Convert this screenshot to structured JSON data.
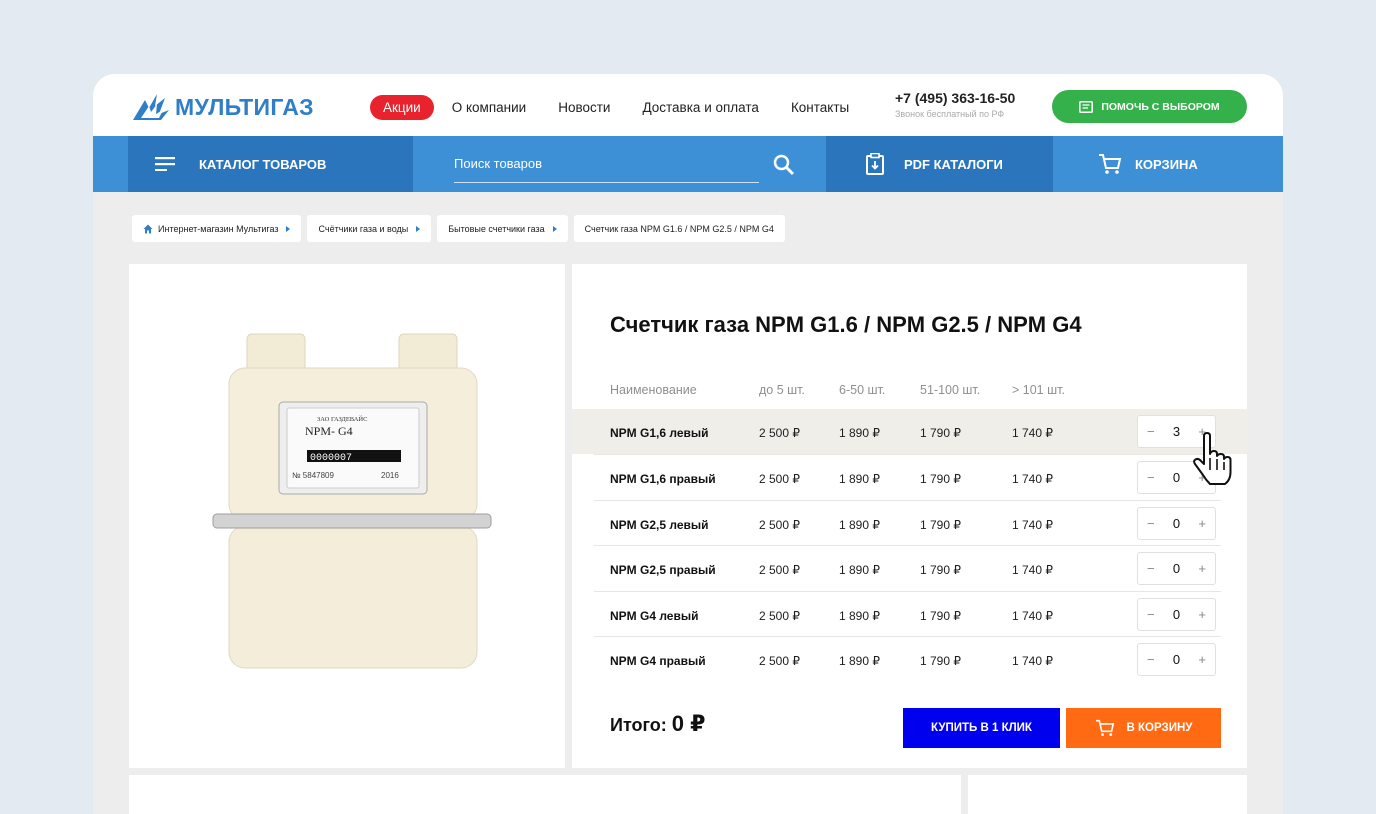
{
  "header": {
    "logo_text": "МУЛЬТИГАЗ",
    "nav": [
      {
        "label": "Акции"
      },
      {
        "label": "О компании"
      },
      {
        "label": "Новости"
      },
      {
        "label": "Доставка и оплата"
      },
      {
        "label": "Контакты"
      }
    ],
    "phone": "+7 (495) 363-16-50",
    "phone_sub": "Звонок бесплатный по РФ",
    "help_button": "ПОМОЧЬ С ВЫБОРОМ"
  },
  "bar": {
    "catalog": "КАТАЛОГ ТОВАРОВ",
    "search_placeholder": "Поиск товаров",
    "pdf": "PDF КАТАЛОГИ",
    "cart": "КОРЗИНА"
  },
  "breadcrumbs": [
    "Интернет-магазин Мультигаз",
    "Счётчики газа и воды",
    "Бытовые счетчики газа",
    "Счетчик газа NPM G1.6 / NPM G2.5 / NPM G4"
  ],
  "product": {
    "title": "Счетчик газа NPM G1.6 / NPM G2.5 / NPM G4",
    "image_labels": {
      "maker": "ЗАО ГАЗДЕВАЙС",
      "model": "NPM- G4",
      "counter": "0000007",
      "serial": "№ 5847809",
      "year": "2016"
    },
    "columns": [
      "Наименование",
      "до 5 шт.",
      "6-50 шт.",
      "51-100 шт.",
      "> 101 шт."
    ],
    "rows": [
      {
        "name": "NPM G1,6 левый",
        "p1": "2 500 ₽",
        "p2": "1 890 ₽",
        "p3": "1 790 ₽",
        "p4": "1 740 ₽",
        "qty": "3"
      },
      {
        "name": "NPM G1,6 правый",
        "p1": "2 500 ₽",
        "p2": "1 890 ₽",
        "p3": "1 790 ₽",
        "p4": "1 740 ₽",
        "qty": "0"
      },
      {
        "name": "NPM G2,5 левый",
        "p1": "2 500 ₽",
        "p2": "1 890 ₽",
        "p3": "1 790 ₽",
        "p4": "1 740 ₽",
        "qty": "0"
      },
      {
        "name": "NPM G2,5 правый",
        "p1": "2 500 ₽",
        "p2": "1 890 ₽",
        "p3": "1 790 ₽",
        "p4": "1 740 ₽",
        "qty": "0"
      },
      {
        "name": "NPM G4 левый",
        "p1": "2 500 ₽",
        "p2": "1 890 ₽",
        "p3": "1 790 ₽",
        "p4": "1 740 ₽",
        "qty": "0"
      },
      {
        "name": "NPM G4 правый",
        "p1": "2 500 ₽",
        "p2": "1 890 ₽",
        "p3": "1 790 ₽",
        "p4": "1 740 ₽",
        "qty": "0"
      }
    ],
    "stepper_minus": "−",
    "stepper_plus": "+",
    "total_label": "Итого:",
    "total_value": "0 ₽",
    "buy_one_click": "КУПИТЬ В 1 КЛИК",
    "add_to_cart": "В КОРЗИНУ"
  },
  "colors": {
    "brand_blue": "#3d8fd6",
    "dark_blue": "#2a75bb",
    "promo_red": "#e8232e",
    "help_green": "#34b14b",
    "buy_blue": "#0000ee",
    "cart_orange": "#ff6a13"
  }
}
